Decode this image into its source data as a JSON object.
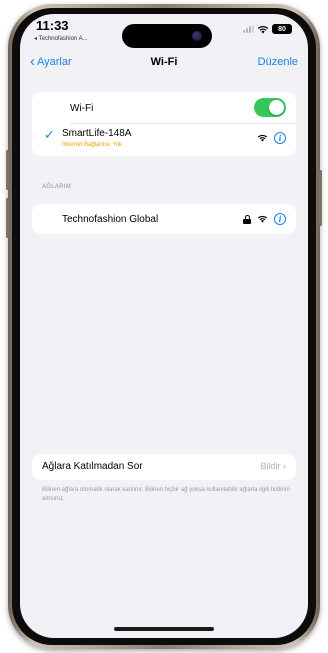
{
  "status_bar": {
    "time": "11:33",
    "back_app": "◂ Technofashion A...",
    "battery": "80"
  },
  "nav": {
    "back_label": "Ayarlar",
    "title": "Wi-Fi",
    "edit_label": "Düzenle"
  },
  "wifi": {
    "label": "Wi-Fi",
    "enabled": true,
    "connected": {
      "name": "SmartLife-148A",
      "status": "İnternet Bağlantısı Yok"
    }
  },
  "networks": {
    "header": "AĞLARIM",
    "items": [
      {
        "name": "Technofashion Global",
        "secured": true
      }
    ]
  },
  "ask_to_join": {
    "label": "Ağlara Katılmadan Sor",
    "value": "Bildir",
    "note": "Bilinen ağlara otomatik olarak katılınır. Bilinen hiçbir ağ yoksa kullanılabilir ağlarla ilgili bildirim alırsınız."
  },
  "colors": {
    "accent": "#1a82e6",
    "toggle_on": "#34c759",
    "warning": "#e8a800",
    "background": "#f2f2f6"
  },
  "icons": [
    "chevron-left-icon",
    "wifi-icon",
    "lock-icon",
    "info-icon",
    "checkmark-icon",
    "chevron-right-icon",
    "signal-icon",
    "battery-icon"
  ]
}
